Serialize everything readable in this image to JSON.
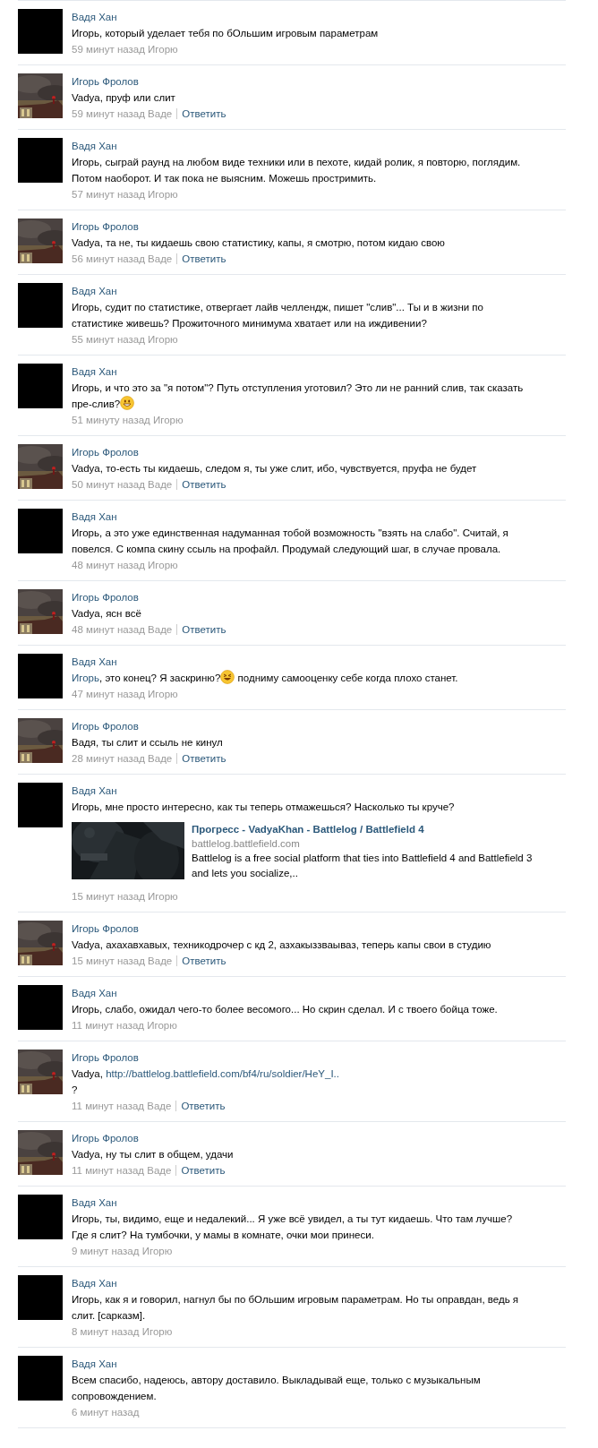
{
  "comments": [
    {
      "author": "Вадя Хан",
      "kind": "blank",
      "text": [
        {
          "kind": "text",
          "text": "Игорь, который уделает тебя по бОльшим игровым параметрам"
        }
      ],
      "time": "59 минут назад Игорю"
    },
    {
      "author": "Игорь Фролов",
      "text": [
        {
          "kind": "text",
          "text": "Vadya, пруф или слит"
        }
      ],
      "time": "59 минут назад Ваде",
      "reply": "Ответить"
    },
    {
      "author": "Вадя Хан",
      "kind": "blank",
      "text": [
        {
          "kind": "text",
          "text": "Игорь, сыграй раунд на любом виде техники или в пехоте, кидай ролик, я повторю, поглядим. Потом наоборот. И так пока не выясним. Можешь простримить."
        }
      ],
      "time": "57 минут назад Игорю"
    },
    {
      "author": "Игорь Фролов",
      "text": [
        {
          "kind": "text",
          "text": "Vadya, та не, ты кидаешь свою статистику, капы, я смотрю, потом кидаю свою"
        }
      ],
      "time": "56 минут назад Ваде",
      "reply": "Ответить"
    },
    {
      "author": "Вадя Хан",
      "kind": "blank",
      "text": [
        {
          "kind": "text",
          "text": "Игорь, судит по статистике, отвергает лайв челлендж, пишет \"слив\"... Ты и в жизни по статистике живешь? Прожиточного минимума хватает или на иждивении?"
        }
      ],
      "time": "55 минут назад Игорю"
    },
    {
      "author": "Вадя Хан",
      "kind": "blank",
      "text": [
        {
          "kind": "text",
          "text": "Игорь, и что это за \"я потом\"? Путь отступления уготовил? Это ли не ранний слив, так сказать пре-слив?"
        },
        {
          "kind": "emoji",
          "squint": false
        }
      ],
      "time": "51 минуту назад Игорю"
    },
    {
      "author": "Игорь Фролов",
      "text": [
        {
          "kind": "text",
          "text": "Vadya, то-есть ты кидаешь, следом я, ты уже слит, ибо, чувствуется, пруфа не будет"
        }
      ],
      "time": "50 минут назад Ваде",
      "reply": "Ответить"
    },
    {
      "author": "Вадя Хан",
      "kind": "blank",
      "text": [
        {
          "kind": "text",
          "text": "Игорь, а это уже единственная надуманная тобой возможность \"взять на слабо\". Считай, я повелся. С компа скину ссыль на профайл. Продумай следующий шаг, в случае провала."
        }
      ],
      "time": "48 минут назад Игорю"
    },
    {
      "author": "Игорь Фролов",
      "text": [
        {
          "kind": "text",
          "text": "Vadya, ясн всё"
        }
      ],
      "time": "48 минут назад Ваде",
      "reply": "Ответить"
    },
    {
      "author": "Вадя Хан",
      "kind": "blank",
      "text": [
        {
          "kind": "link",
          "text": "Игорь"
        },
        {
          "kind": "text",
          "text": ", это конец? Я заскриню?"
        },
        {
          "kind": "emoji",
          "squint": true
        },
        {
          "kind": "text",
          "text": " подниму самооценку себе когда плохо станет."
        }
      ],
      "time": "47 минут назад Игорю"
    },
    {
      "author": "Игорь Фролов",
      "text": [
        {
          "kind": "text",
          "text": "Вадя, ты слит и ссыль не кинул"
        }
      ],
      "time": "28 минут назад Ваде",
      "reply": "Ответить"
    },
    {
      "author": "Вадя Хан",
      "kind": "blank",
      "text": [
        {
          "kind": "text",
          "text": "Игорь, мне просто интересно, как ты теперь отмажешься? Насколько ты круче?"
        }
      ],
      "preview": {
        "title": "Прогресс - VadyaKhan - Battlelog / Battlefield 4",
        "domain": "battlelog.battlefield.com",
        "description": "Battlelog is a free social platform that ties into Battlefield 4 and Battlefield 3 and lets you socialize,.."
      },
      "time": "15 минут назад Игорю"
    },
    {
      "author": "Игорь Фролов",
      "text": [
        {
          "kind": "text",
          "text": "Vadya, ахахавхавых, техникодрочер с кд 2, азхакыззваываз, теперь капы свои в студию"
        }
      ],
      "time": "15 минут назад Ваде",
      "reply": "Ответить"
    },
    {
      "author": "Вадя Хан",
      "kind": "blank",
      "text": [
        {
          "kind": "text",
          "text": "Игорь, слабо, ожидал чего-то более весомого... Но скрин сделал. И с твоего бойца тоже."
        }
      ],
      "time": "11 минут назад Игорю"
    },
    {
      "author": "Игорь Фролов",
      "text": [
        {
          "kind": "text",
          "text": "Vadya, "
        },
        {
          "kind": "link",
          "text": "http://battlelog.battlefield.com/bf4/ru/soldier/HeY_I.."
        },
        {
          "kind": "text",
          "text": "\n?"
        }
      ],
      "time": "11 минут назад Ваде",
      "reply": "Ответить"
    },
    {
      "author": "Игорь Фролов",
      "text": [
        {
          "kind": "text",
          "text": "Vadya, ну ты слит в общем, удачи"
        }
      ],
      "time": "11 минут назад Ваде",
      "reply": "Ответить"
    },
    {
      "author": "Вадя Хан",
      "kind": "blank",
      "text": [
        {
          "kind": "text",
          "text": "Игорь, ты, видимо, еще и недалекий... Я уже всё увидел, а ты тут кидаешь. Что там лучше? Где я слит? На тумбочки, у мамы в комнате, очки мои принеси."
        }
      ],
      "time": "9 минут назад Игорю"
    },
    {
      "author": "Вадя Хан",
      "kind": "blank",
      "text": [
        {
          "kind": "text",
          "text": "Игорь, как я и говорил, нагнул бы по бОльшим игровым параметрам. Но ты оправдан, ведь я слит. [сарказм]."
        }
      ],
      "time": "8 минут назад Игорю"
    },
    {
      "author": "Вадя Хан",
      "kind": "blank",
      "text": [
        {
          "kind": "text",
          "text": "Всем спасибо, надеюсь, автору доставило. Выкладывай еще, только с музыкальным сопровождением."
        }
      ],
      "time": "6 минут назад"
    }
  ]
}
